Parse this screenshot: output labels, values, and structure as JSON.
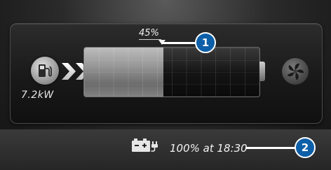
{
  "charging": {
    "power_label": "7.2kW",
    "icon": "charging-station-icon"
  },
  "battery": {
    "level_label": "45%",
    "level_fraction": 0.45
  },
  "climate": {
    "icon": "fan-icon"
  },
  "status": {
    "icon": "battery-plug-icon",
    "text": "100% at 18:30"
  },
  "callouts": [
    {
      "label": "1"
    },
    {
      "label": "2"
    }
  ],
  "colors": {
    "callout_blue": "#0d5fa8",
    "panel_dark": "#191919"
  }
}
